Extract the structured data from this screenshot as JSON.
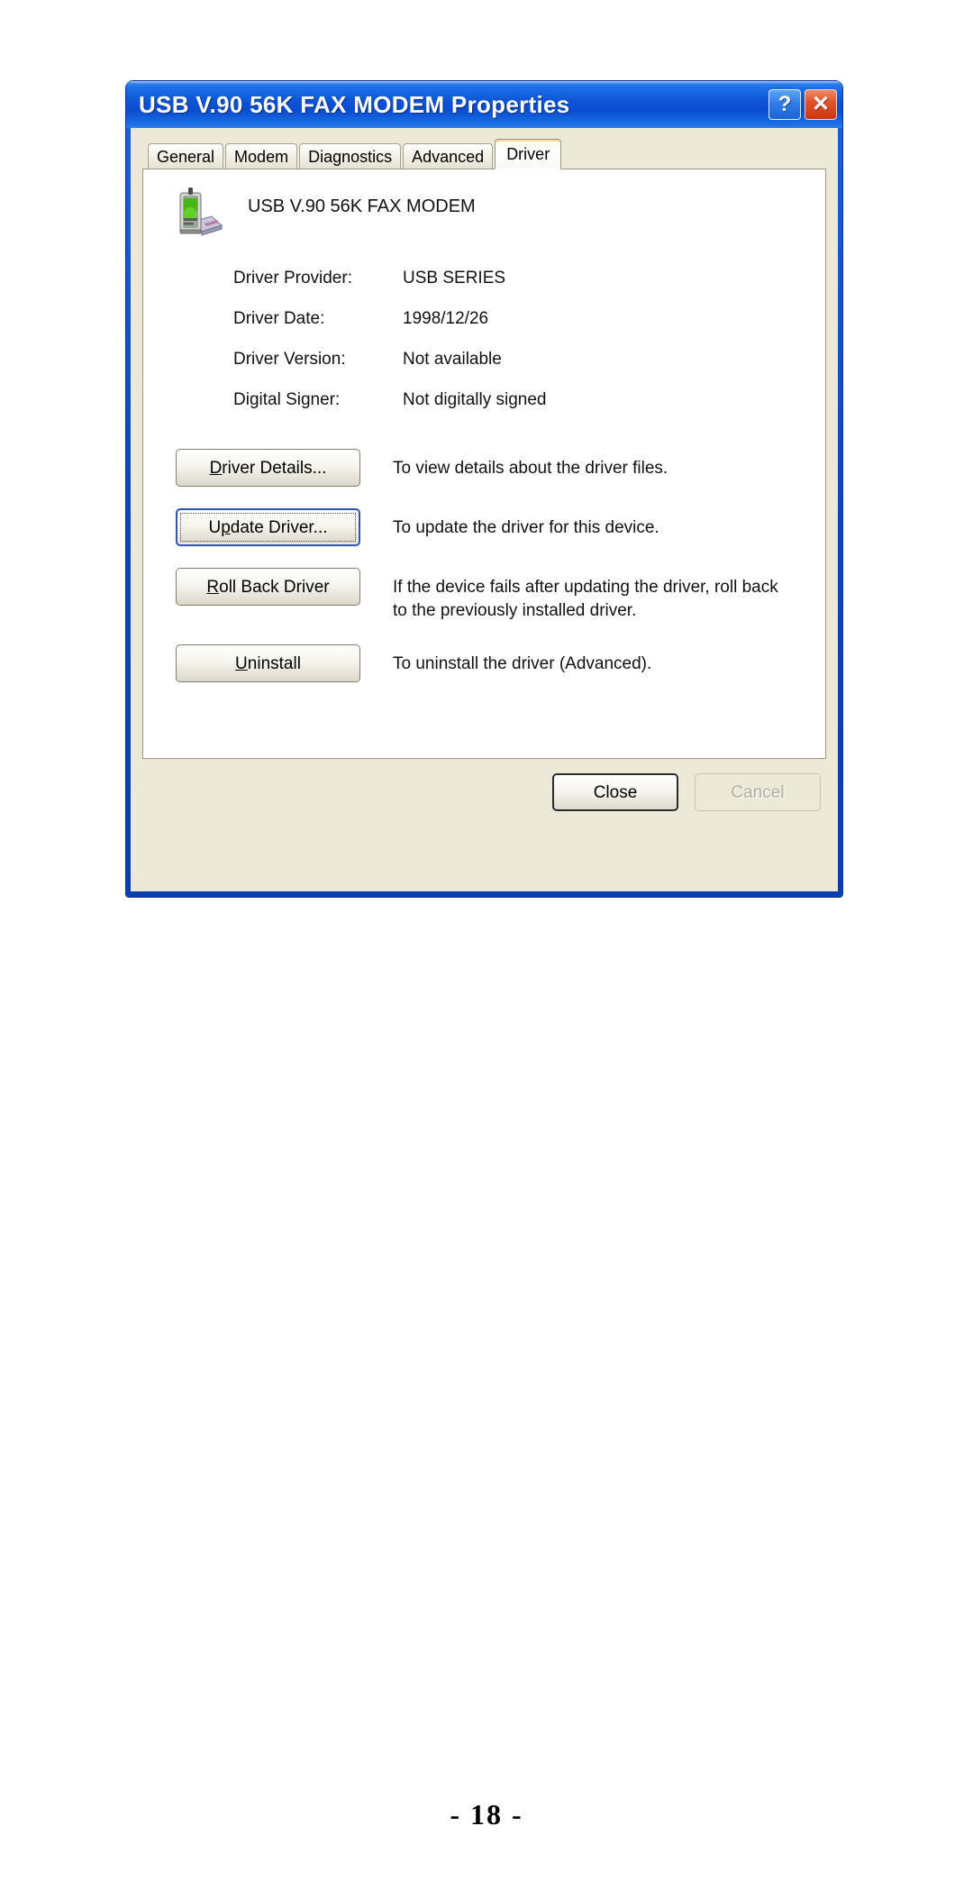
{
  "window": {
    "title": "USB V.90 56K FAX MODEM Properties",
    "help_button_label": "?",
    "close_button_label": "✕",
    "frame_color": "#0a47b8",
    "titlebar_gradient_start": "#3b8ef0",
    "dialog_background": "#ece9d8"
  },
  "tabs": [
    {
      "label": "General",
      "active": false
    },
    {
      "label": "Modem",
      "active": false
    },
    {
      "label": "Diagnostics",
      "active": false
    },
    {
      "label": "Advanced",
      "active": false
    },
    {
      "label": "Driver",
      "active": true
    }
  ],
  "device": {
    "icon": "modem-icon",
    "name": "USB V.90 56K FAX MODEM"
  },
  "driver_info": [
    {
      "label": "Driver Provider:",
      "value": "USB SERIES"
    },
    {
      "label": "Driver Date:",
      "value": "1998/12/26"
    },
    {
      "label": "Driver Version:",
      "value": "Not available"
    },
    {
      "label": "Digital Signer:",
      "value": "Not digitally signed"
    }
  ],
  "actions": [
    {
      "button_label": "Driver Details...",
      "accelerator": "D",
      "focused": false,
      "description": "To view details about the driver files."
    },
    {
      "button_label": "Update Driver...",
      "accelerator": "p",
      "focused": true,
      "description": "To update the driver for this device."
    },
    {
      "button_label": "Roll Back Driver",
      "accelerator": "R",
      "focused": false,
      "description": "If the device fails after updating the driver, roll back to the previously installed driver."
    },
    {
      "button_label": "Uninstall",
      "accelerator": "U",
      "focused": false,
      "description": "To uninstall the driver (Advanced)."
    }
  ],
  "footer": {
    "close_label": "Close",
    "cancel_label": "Cancel",
    "cancel_disabled": true
  },
  "page": {
    "number_label": "- 18 -"
  }
}
